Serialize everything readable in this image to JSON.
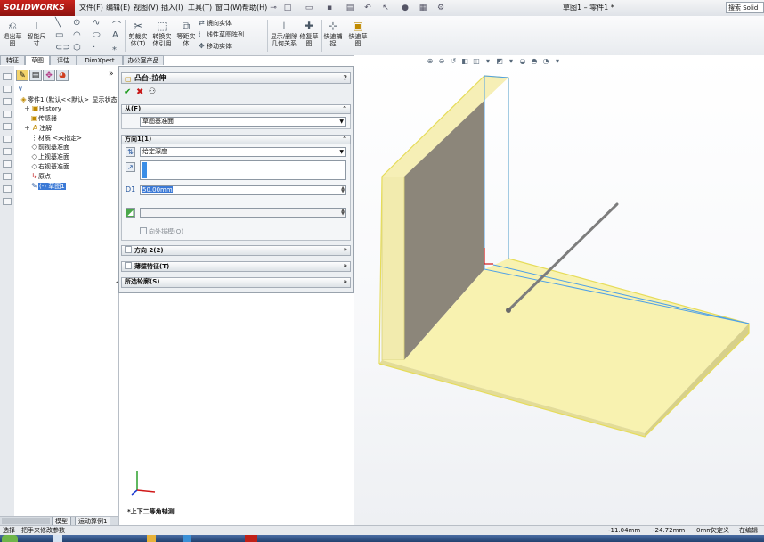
{
  "app": {
    "logo_text": "SOLIDWORKS",
    "doc_title": "草图1 – 零件1 *",
    "search_placeholder": "搜索 Solid"
  },
  "menu": [
    "文件(F)",
    "编辑(E)",
    "视图(V)",
    "插入(I)",
    "工具(T)",
    "窗口(W)",
    "帮助(H)"
  ],
  "command_manager": {
    "tools": [
      {
        "label": "退出草图",
        "icon": "exit-sketch-icon"
      },
      {
        "label": "智能尺寸",
        "icon": "smart-dimension-icon"
      },
      {
        "label": "剪裁实体(T)",
        "icon": "trim-entities-icon"
      },
      {
        "label": "转换实体引用",
        "icon": "convert-entities-icon"
      },
      {
        "label": "等距实体",
        "icon": "offset-entities-icon"
      },
      {
        "label": "显示/删除几何关系",
        "icon": "display-relations-icon"
      },
      {
        "label": "修复草图",
        "icon": "repair-sketch-icon"
      },
      {
        "label": "快速捕捉",
        "icon": "quick-snaps-icon"
      },
      {
        "label": "快速草图",
        "icon": "rapid-sketch-icon"
      }
    ],
    "small_tools": [
      "镜向实体",
      "线性草图阵列",
      "移动实体"
    ]
  },
  "command_tabs": [
    "特征",
    "草图",
    "评估",
    "DimXpert",
    "办公室产品"
  ],
  "command_tab_active": 1,
  "feature_tree": [
    {
      "label": "零件1 (默认<<默认>_显示状态",
      "icon": "part-icon"
    },
    {
      "label": "History",
      "icon": "history-icon"
    },
    {
      "label": "传感器",
      "icon": "sensors-icon"
    },
    {
      "label": "注解",
      "icon": "annotations-icon"
    },
    {
      "label": "材质 <未指定>",
      "icon": "material-icon"
    },
    {
      "label": "前视基准面",
      "icon": "plane-icon"
    },
    {
      "label": "上视基准面",
      "icon": "plane-icon"
    },
    {
      "label": "右视基准面",
      "icon": "plane-icon"
    },
    {
      "label": "原点",
      "icon": "origin-icon"
    },
    {
      "label": "(-) 草图1",
      "icon": "sketch-icon",
      "selected": true
    }
  ],
  "bottom_tabs": [
    "模型",
    "运动算例1"
  ],
  "property_manager": {
    "title": "凸台-拉伸",
    "help": "?",
    "from": {
      "header": "从(F)",
      "value": "草图基准面"
    },
    "direction1": {
      "header": "方向1(1)",
      "end_condition": "给定深度",
      "depth": "50.00mm",
      "draft_label": "向外拔模(O)"
    },
    "direction2": {
      "header": "方向 2(2)"
    },
    "thin_feature": {
      "header": "薄壁特征(T)"
    },
    "selected_contours": {
      "header": "所选轮廓(S)"
    }
  },
  "viewport": {
    "view_label": "*上下二等角轴测"
  },
  "status": {
    "message": "选择一把手来修改参数",
    "x": "-11.04mm",
    "y": "-24.72mm",
    "z": "0mm",
    "state": "欠定义",
    "editing": "在编辑"
  }
}
